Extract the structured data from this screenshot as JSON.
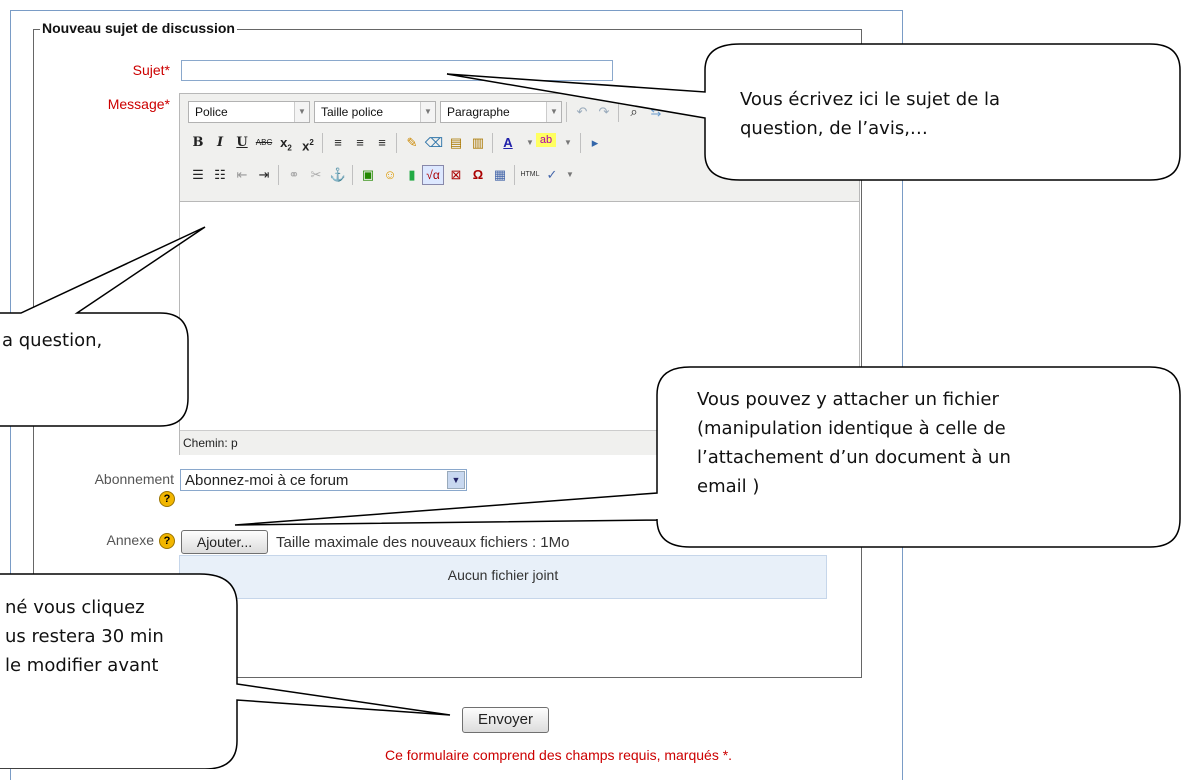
{
  "form": {
    "legend": "Nouveau sujet de discussion",
    "subject_label": "Sujet",
    "message_label": "Message",
    "required_mark": "*",
    "subject_value": "",
    "toolbar": {
      "font_dropdown": "Police",
      "size_dropdown": "Taille police",
      "format_dropdown": "Paragraphe",
      "bold": "B",
      "italic": "I",
      "underline": "U",
      "strike": "ABC",
      "omega": "Ω"
    },
    "path_label": "Chemin: p",
    "subscription_label": "Abonnement",
    "subscription_value": "Abonnez-moi à ce forum",
    "attachment_label": "Annexe",
    "add_button": "Ajouter...",
    "max_size_text": "Taille maximale des nouveaux fichiers : 1Mo",
    "no_file_text": "Aucun fichier joint",
    "submit_button": "Envoyer",
    "required_note": "Ce formulaire comprend des champs requis, marqués *."
  },
  "callouts": {
    "subject_line1": "Vous écrivez ici le sujet de la",
    "subject_line2": "question, de l’avis,…",
    "message_line1": "a question,",
    "attach_line1": "Vous pouvez y attacher un fichier",
    "attach_line2": "(manipulation identique à celle de",
    "attach_line3": "l’attachement d’un document à un",
    "attach_line4": "email )",
    "submit_line1": "né vous cliquez",
    "submit_line2": "us restera 30 min",
    "submit_line3": "le modifier avant"
  },
  "colors": {
    "panel_border": "#7a9cc6",
    "required": "#cc0000",
    "help_icon": "#f2b600",
    "file_box": "#e8f0f9"
  }
}
